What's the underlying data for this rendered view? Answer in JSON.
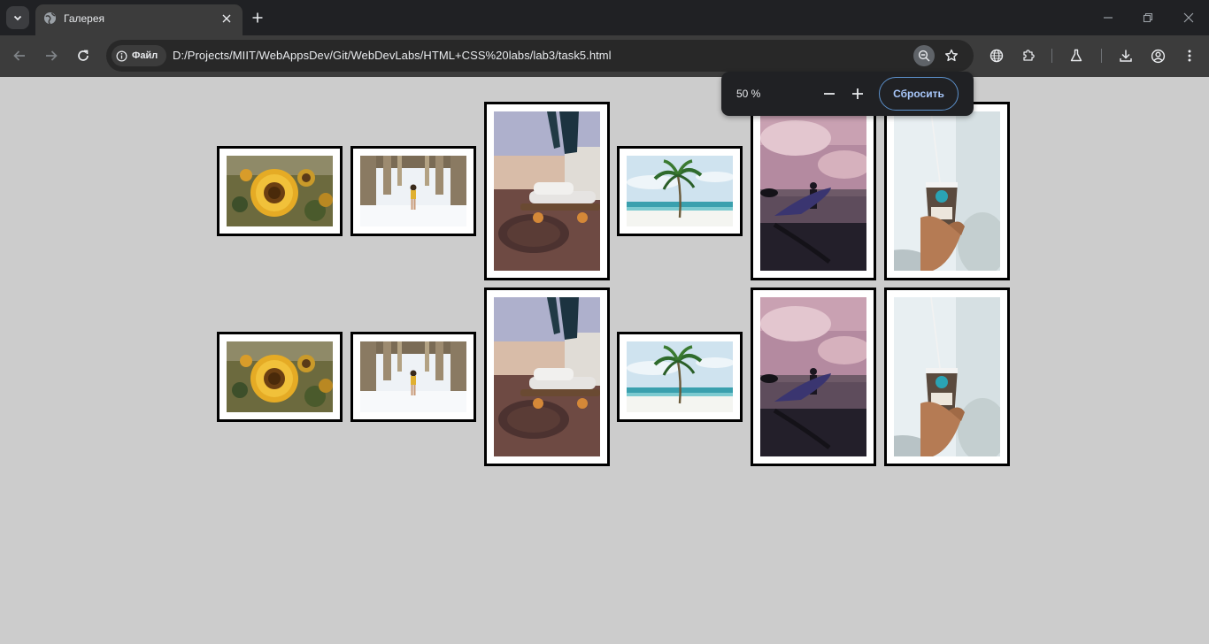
{
  "browser": {
    "tab": {
      "title": "Галерея"
    },
    "omnibox": {
      "chip_label": "Файл",
      "url": "D:/Projects/MIIT/WebAppsDev/Git/WebDevLabs/HTML+CSS%20labs/lab3/task5.html"
    },
    "zoom_popup": {
      "level": "50 %",
      "reset_label": "Сбросить"
    }
  },
  "gallery": {
    "rows": [
      {
        "images": [
          "sunflower",
          "pier-girl",
          "skateboard",
          "palm-tree",
          "surfer",
          "coffee-cup"
        ]
      },
      {
        "images": [
          "sunflower",
          "pier-girl",
          "skateboard",
          "palm-tree",
          "surfer",
          "coffee-cup"
        ]
      }
    ]
  },
  "colors": {
    "page_background": "#cccccc",
    "frame_border": "#000000",
    "frame_fill": "#ffffff",
    "accent": "#a8c7fa"
  }
}
